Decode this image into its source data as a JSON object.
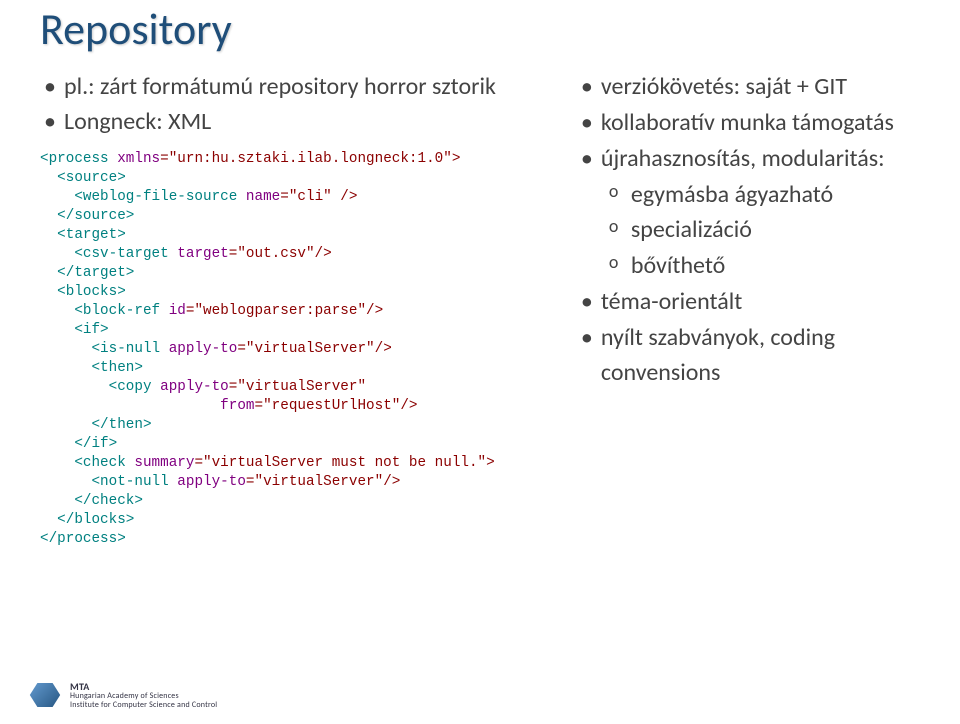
{
  "title": "Repository",
  "left": {
    "bullets": [
      "pl.: zárt formátumú repository horror sztorik",
      "Longneck: XML"
    ],
    "code": {
      "l1a": "<process",
      "l1b": " xmlns",
      "l1c": "=\"urn:hu.sztaki.ilab.longneck:1.0\">",
      "l2a": "  <source>",
      "l3a": "    <weblog-file-source",
      "l3b": " name",
      "l3c": "=\"cli\" />",
      "l4a": "  </source>",
      "l5a": "  <target>",
      "l6a": "    <csv-target",
      "l6b": " target",
      "l6c": "=\"out.csv\"/>",
      "l7a": "  </target>",
      "l8a": "  <blocks>",
      "l9a": "    <block-ref",
      "l9b": " id",
      "l9c": "=\"weblogparser:parse\"/>",
      "l10a": "    <if>",
      "l11a": "      <is-null",
      "l11b": " apply-to",
      "l11c": "=\"virtualServer\"/>",
      "l12a": "      <then>",
      "l13a": "        <copy",
      "l13b": " apply-to",
      "l13c": "=\"virtualServer\"",
      "l14a": "                     ",
      "l14b": "from",
      "l14c": "=\"requestUrlHost\"/>",
      "l15a": "      </then>",
      "l16a": "    </if>",
      "l17a": "    <check",
      "l17b": " summary",
      "l17c": "=\"virtualServer must not be null.\">",
      "l18a": "      <not-null",
      "l18b": " apply-to",
      "l18c": "=\"virtualServer\"/>",
      "l19a": "    </check>",
      "l20a": "  </blocks>",
      "l21a": "</process>"
    }
  },
  "right": {
    "bullets": [
      "verziókövetés: saját + GIT",
      "kollaboratív munka támogatás",
      "újrahasznosítás, modularitás:"
    ],
    "sub_bullets": [
      "egymásba ágyazható",
      "specializáció",
      "bővíthető"
    ],
    "bullets_after": [
      "téma-orientált",
      "nyílt szabványok, coding convensions"
    ]
  },
  "footer": {
    "org1": "MTA",
    "org2": "Hungarian Academy of Sciences",
    "org3": "Institute for Computer Science and Control"
  }
}
